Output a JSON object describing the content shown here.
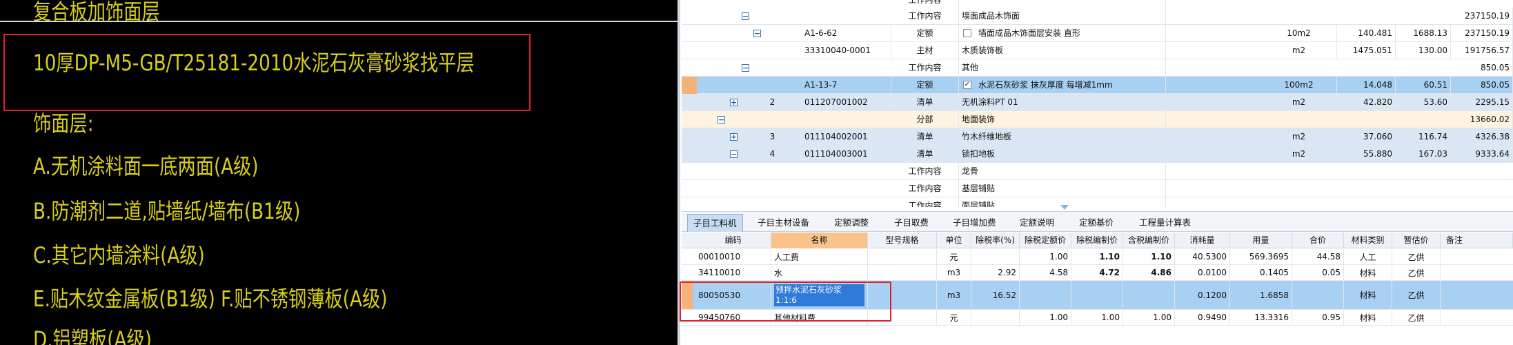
{
  "cad": {
    "title_partial": "复合板加饰面层",
    "highlight_text": "10厚DP-M5-GB/T25181-2010水泥石灰膏砂浆找平层",
    "facing_label": "饰面层:",
    "items": [
      "A.无机涂料面一底两面(A级)",
      "B.防潮剂二道,贴墙纸/墙布(B1级)",
      "C.其它内墙涂料(A级)",
      "E.贴木纹金属板(B1级)  F.贴不锈钢薄板(A级)",
      "D.铝塑板(A级)"
    ]
  },
  "upper_rows": [
    {
      "type": "工作内容",
      "name": "",
      "code": "",
      "unit": "",
      "qty": "",
      "price": "",
      "total": ""
    },
    {
      "type": "工作内容",
      "name": "墙面成品木饰面",
      "code": "",
      "unit": "",
      "qty": "",
      "price": "",
      "total": "237150.19"
    },
    {
      "type": "定额",
      "name": "墙面成品木饰面层安装 直形",
      "code": "A1-6-62",
      "unit": "10m2",
      "qty": "140.481",
      "price": "1688.13",
      "total": "237150.19"
    },
    {
      "type": "主材",
      "name": "木质装饰板",
      "code": "33310040-0001",
      "unit": "m2",
      "qty": "1475.051",
      "price": "130.00",
      "total": "191756.57"
    },
    {
      "type": "工作内容",
      "name": "其他",
      "code": "",
      "unit": "",
      "qty": "",
      "price": "",
      "total": "850.05"
    },
    {
      "type": "定额",
      "name": "水泥石灰砂浆 抹灰厚度 每增减1mm",
      "code": "A1-13-7",
      "unit": "100m2",
      "qty": "14.048",
      "price": "60.51",
      "total": "850.05"
    },
    {
      "type": "清单",
      "num": "2",
      "name": "无机涂料PT 01",
      "code": "011207001002",
      "unit": "m2",
      "qty": "42.820",
      "price": "53.60",
      "total": "2295.15"
    },
    {
      "type": "分部",
      "name": "地面装饰",
      "code": "",
      "unit": "",
      "qty": "",
      "price": "",
      "total": "13660.02"
    },
    {
      "type": "清单",
      "num": "3",
      "name": "竹木纤维地板",
      "code": "011104002001",
      "unit": "m2",
      "qty": "37.060",
      "price": "116.74",
      "total": "4326.38"
    },
    {
      "type": "清单",
      "num": "4",
      "name": "锁扣地板",
      "code": "011104003001",
      "unit": "m2",
      "qty": "55.880",
      "price": "167.03",
      "total": "9333.64"
    },
    {
      "type": "工作内容",
      "name": "龙骨",
      "code": "",
      "unit": "",
      "qty": "",
      "price": "",
      "total": ""
    },
    {
      "type": "工作内容",
      "name": "基层铺贴",
      "code": "",
      "unit": "",
      "qty": "",
      "price": "",
      "total": ""
    },
    {
      "type": "工作内容",
      "name": "面层铺贴",
      "code": "",
      "unit": "",
      "qty": "",
      "price": "",
      "total": ""
    }
  ],
  "tabs": [
    "子目工料机",
    "子目主材设备",
    "定额调整",
    "子目取费",
    "子目增加费",
    "定额说明",
    "定额基价",
    "工程量计算表"
  ],
  "lower_headers": [
    "编码",
    "名称",
    "型号规格",
    "单位",
    "除税率(%)",
    "除税定额价",
    "除税编制价",
    "含税编制价",
    "消耗量",
    "用量",
    "合价",
    "材料类别",
    "暂估价",
    "备注"
  ],
  "lower_rows": [
    {
      "code": "00010010",
      "name": "人工费",
      "spec": "",
      "unit": "元",
      "tax": "",
      "p1": "1.00",
      "p2": "1.10",
      "p3": "1.10",
      "cons": "40.5300",
      "usage": "569.3695",
      "sum": "44.58",
      "cat": "人工",
      "est": "乙供"
    },
    {
      "code": "34110010",
      "name": "水",
      "spec": "",
      "unit": "m3",
      "tax": "2.92",
      "p1": "4.58",
      "p2": "4.72",
      "p3": "4.86",
      "cons": "0.0100",
      "usage": "0.1405",
      "sum": "0.05",
      "cat": "材料",
      "est": "乙供"
    },
    {
      "code": "80050530",
      "name": "预拌水泥石灰砂浆 1:1:6",
      "spec": "",
      "unit": "m3",
      "tax": "16.52",
      "p1": "",
      "p2": "",
      "p3": "",
      "cons": "0.1200",
      "usage": "1.6858",
      "sum": "",
      "cat": "材料",
      "est": "乙供"
    },
    {
      "code": "99450760",
      "name": "其他材料费",
      "spec": "",
      "unit": "元",
      "tax": "",
      "p1": "1.00",
      "p2": "1.00",
      "p3": "1.00",
      "cons": "0.9490",
      "usage": "13.3316",
      "sum": "0.95",
      "cat": "材料",
      "est": "乙供"
    }
  ]
}
